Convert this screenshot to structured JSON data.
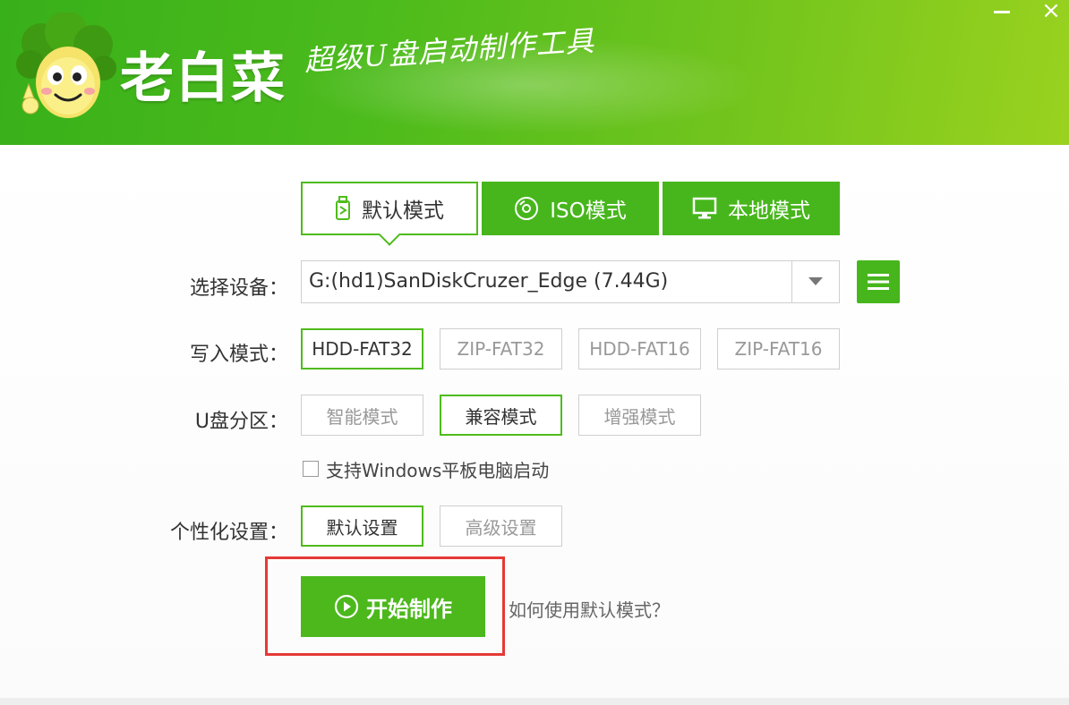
{
  "header": {
    "app_title": "老白菜",
    "slogan": "超级U盘启动制作工具",
    "minimize_label": "",
    "close_label": "×"
  },
  "tabs": [
    {
      "label": "默认模式",
      "icon": "usb-drive-icon",
      "active": true
    },
    {
      "label": "ISO模式",
      "icon": "disc-icon",
      "active": false
    },
    {
      "label": "本地模式",
      "icon": "monitor-icon",
      "active": false
    }
  ],
  "device": {
    "label": "选择设备：",
    "value": "G:(hd1)SanDiskCruzer_Edge (7.44G)",
    "menu_icon": "menu-icon"
  },
  "write_mode": {
    "label": "写入模式：",
    "options": [
      "HDD-FAT32",
      "ZIP-FAT32",
      "HDD-FAT16",
      "ZIP-FAT16"
    ],
    "selected": "HDD-FAT32"
  },
  "partition": {
    "label": "U盘分区：",
    "options": [
      "智能模式",
      "兼容模式",
      "增强模式"
    ],
    "selected": "兼容模式"
  },
  "tablet_boot": {
    "label": "支持Windows平板电脑启动",
    "checked": false
  },
  "personalize": {
    "label": "个性化设置：",
    "options": [
      "默认设置",
      "高级设置"
    ],
    "selected": "默认设置"
  },
  "start_button": {
    "label": "开始制作",
    "icon": "play-icon"
  },
  "help_link": "如何使用默认模式？",
  "colors": {
    "brand_green": "#47b61c",
    "highlight_red": "#e53935"
  }
}
